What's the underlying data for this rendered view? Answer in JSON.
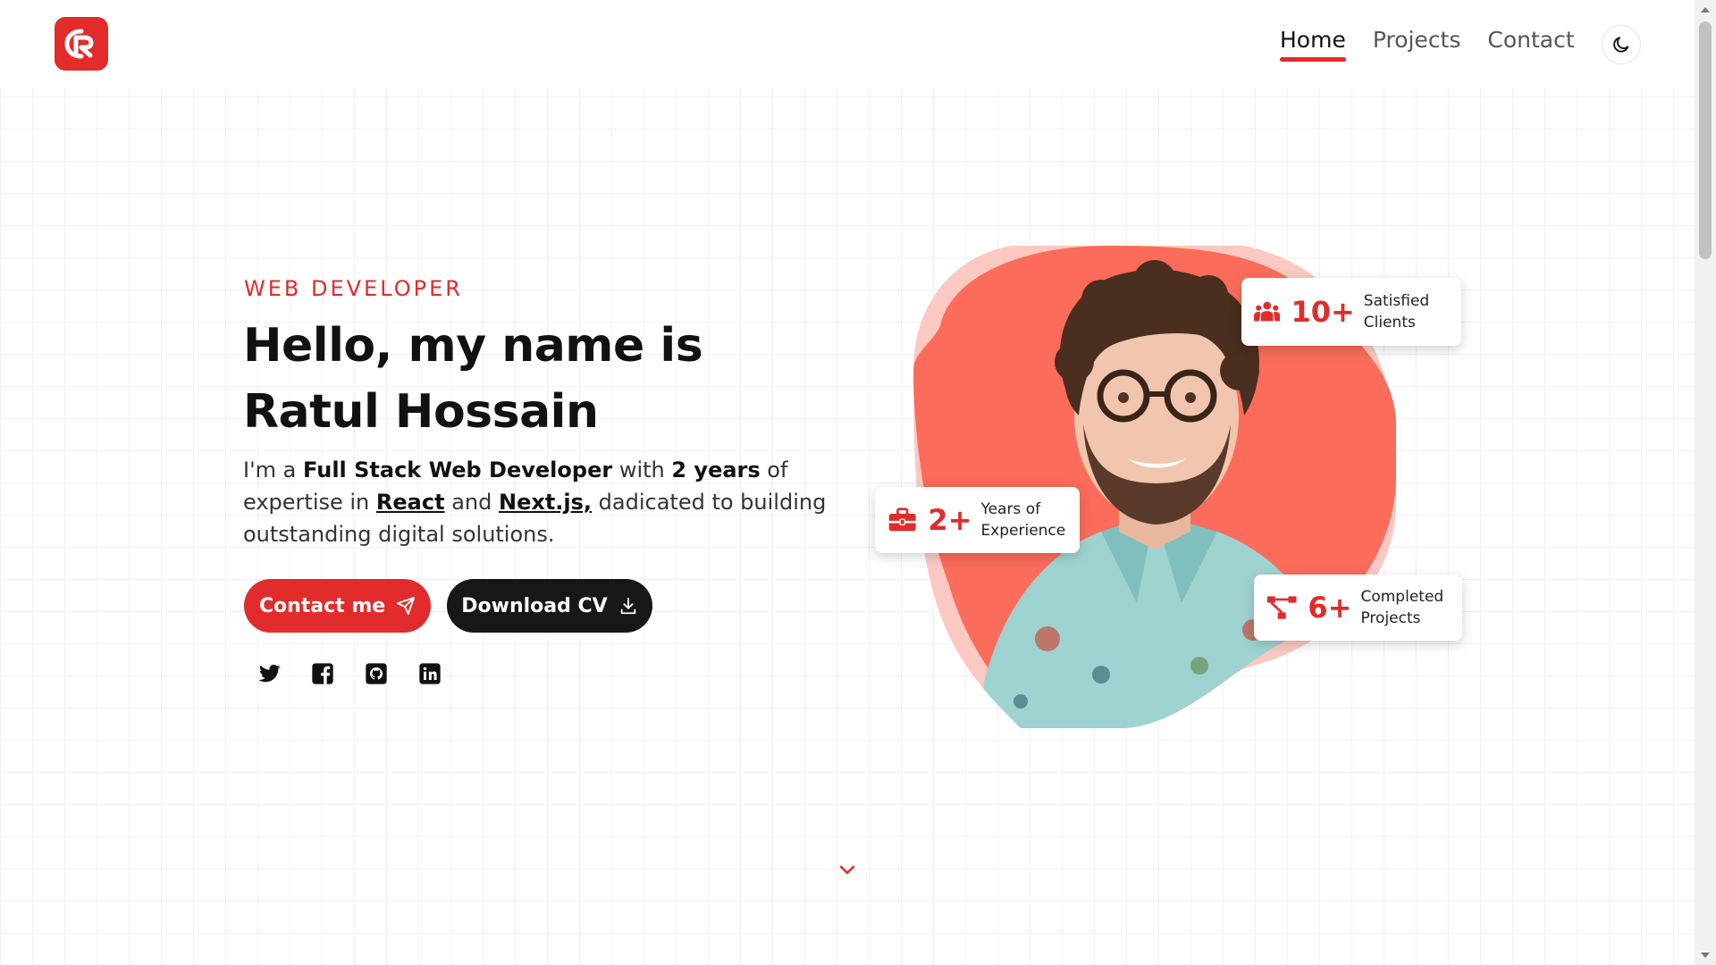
{
  "header": {
    "logo_alt": "R",
    "nav": [
      {
        "label": "Home",
        "active": true
      },
      {
        "label": "Projects",
        "active": false
      },
      {
        "label": "Contact",
        "active": false
      }
    ],
    "theme_toggle_icon": "moon-icon"
  },
  "hero": {
    "eyebrow": "WEB DEVELOPER",
    "headline_line1": "Hello, my name is",
    "headline_line2": "Ratul Hossain",
    "intro": {
      "part1": "I'm a ",
      "role": "Full Stack Web Developer",
      "part2": " with ",
      "years": "2 years",
      "part3": " of expertise in ",
      "tech1": "React",
      "part4": " and ",
      "tech2": "Next.js,",
      "part5": " dadicated to building outstanding digital solutions."
    },
    "buttons": {
      "contact_label": "Contact me",
      "contact_icon": "send-icon",
      "cv_label": "Download CV",
      "cv_icon": "download-icon"
    },
    "socials": [
      "twitter-icon",
      "facebook-icon",
      "github-icon",
      "linkedin-icon"
    ]
  },
  "stats": [
    {
      "value": "10+",
      "label": "Satisfied Clients",
      "icon": "users-icon"
    },
    {
      "value": "2+",
      "label": "Years of Experience",
      "icon": "briefcase-icon"
    },
    {
      "value": "6+",
      "label": "Completed Projects",
      "icon": "flowchart-icon"
    }
  ],
  "colors": {
    "accent": "#e22b2b",
    "blob": "#fb6c5a",
    "blob_light": "#fcc9c2",
    "dark_button": "#171717"
  },
  "scroll_indicator_icon": "chevron-down-icon"
}
